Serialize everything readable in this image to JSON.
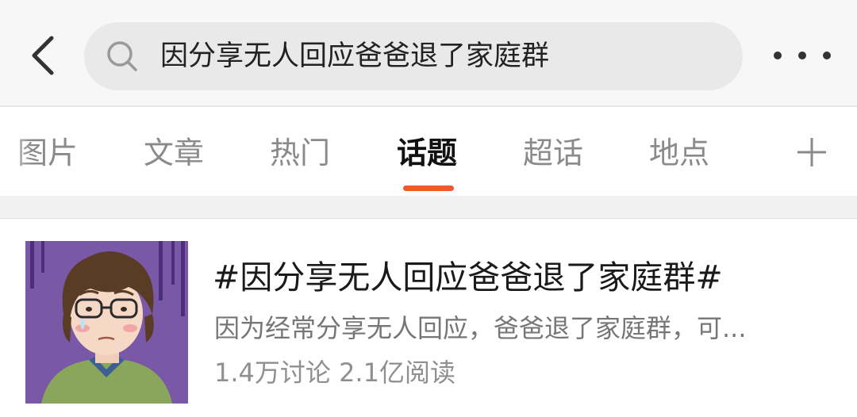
{
  "search": {
    "query": "因分享无人回应爸爸退了家庭群"
  },
  "icons": {
    "back": "back-chevron-icon",
    "search": "search-icon",
    "more": "more-dots-icon",
    "add": "plus-icon"
  },
  "tabs": [
    {
      "label": "图片",
      "active": false
    },
    {
      "label": "文章",
      "active": false
    },
    {
      "label": "热门",
      "active": false
    },
    {
      "label": "话题",
      "active": true
    },
    {
      "label": "超话",
      "active": false
    },
    {
      "label": "地点",
      "active": false
    }
  ],
  "colors": {
    "accent": "#ee5a2a",
    "active_tab_text": "#111111",
    "inactive_tab_text": "#8a8a8a"
  },
  "result": {
    "title": "#因分享无人回应爸爸退了家庭群#",
    "description": "因为经常分享无人回应，爸爸退了家庭群，可...",
    "stats": "1.4万讨论 2.1亿阅读"
  }
}
